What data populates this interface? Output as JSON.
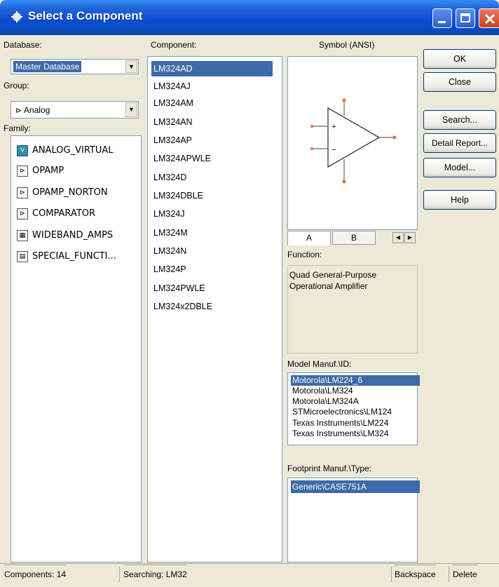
{
  "window": {
    "title": "Select a Component"
  },
  "labels": {
    "database": "Database:",
    "component": "Component:",
    "symbol": "Symbol (ANSI)",
    "group": "Group:",
    "family": "Family:",
    "function": "Function:",
    "model_manuf": "Model Manuf.\\ID:",
    "footprint_manuf": "Footprint Manuf.\\Type:"
  },
  "database": {
    "selected": "Master Database"
  },
  "group": {
    "selected": "Analog",
    "icon": "analog-icon"
  },
  "families": [
    {
      "label": "ANALOG_VIRTUAL",
      "icon": "analog-virtual-icon"
    },
    {
      "label": "OPAMP",
      "icon": "opamp-icon"
    },
    {
      "label": "OPAMP_NORTON",
      "icon": "opamp-norton-icon"
    },
    {
      "label": "COMPARATOR",
      "icon": "comparator-icon"
    },
    {
      "label": "WIDEBAND_AMPS",
      "icon": "wideband-amps-icon"
    },
    {
      "label": "SPECIAL_FUNCTI...",
      "icon": "special-function-icon"
    }
  ],
  "components": [
    "LM324AD",
    "LM324AJ",
    "LM324AM",
    "LM324AN",
    "LM324AP",
    "LM324APWLE",
    "LM324D",
    "LM324DBLE",
    "LM324J",
    "LM324M",
    "LM324N",
    "LM324P",
    "LM324PWLE",
    "LM324x2DBLE"
  ],
  "selected_component": "LM324AD",
  "symbol_tabs": [
    "A",
    "B"
  ],
  "function_text": {
    "line1": "Quad General-Purpose",
    "line2": "Operational Amplifier"
  },
  "model_manuf_items": [
    "Motorola\\LM224_6",
    "Motorola\\LM324",
    "Motorola\\LM324A",
    "STMicroelectronics\\LM124",
    "Texas Instruments\\LM224",
    "Texas Instruments\\LM324"
  ],
  "footprint_items": [
    "Generic\\CASE751A"
  ],
  "buttons": {
    "ok": "OK",
    "close": "Close",
    "search": "Search...",
    "detail_report": "Detail Report...",
    "model": "Model...",
    "help": "Help"
  },
  "status": {
    "components": "Components: 14",
    "searching": "Searching: LM32",
    "backspace": "Backspace",
    "delete": "Delete"
  },
  "colors": {
    "title_blue": "#0a4ed1",
    "selection": "#3d6aa8",
    "window_bg": "#ece9d8"
  }
}
